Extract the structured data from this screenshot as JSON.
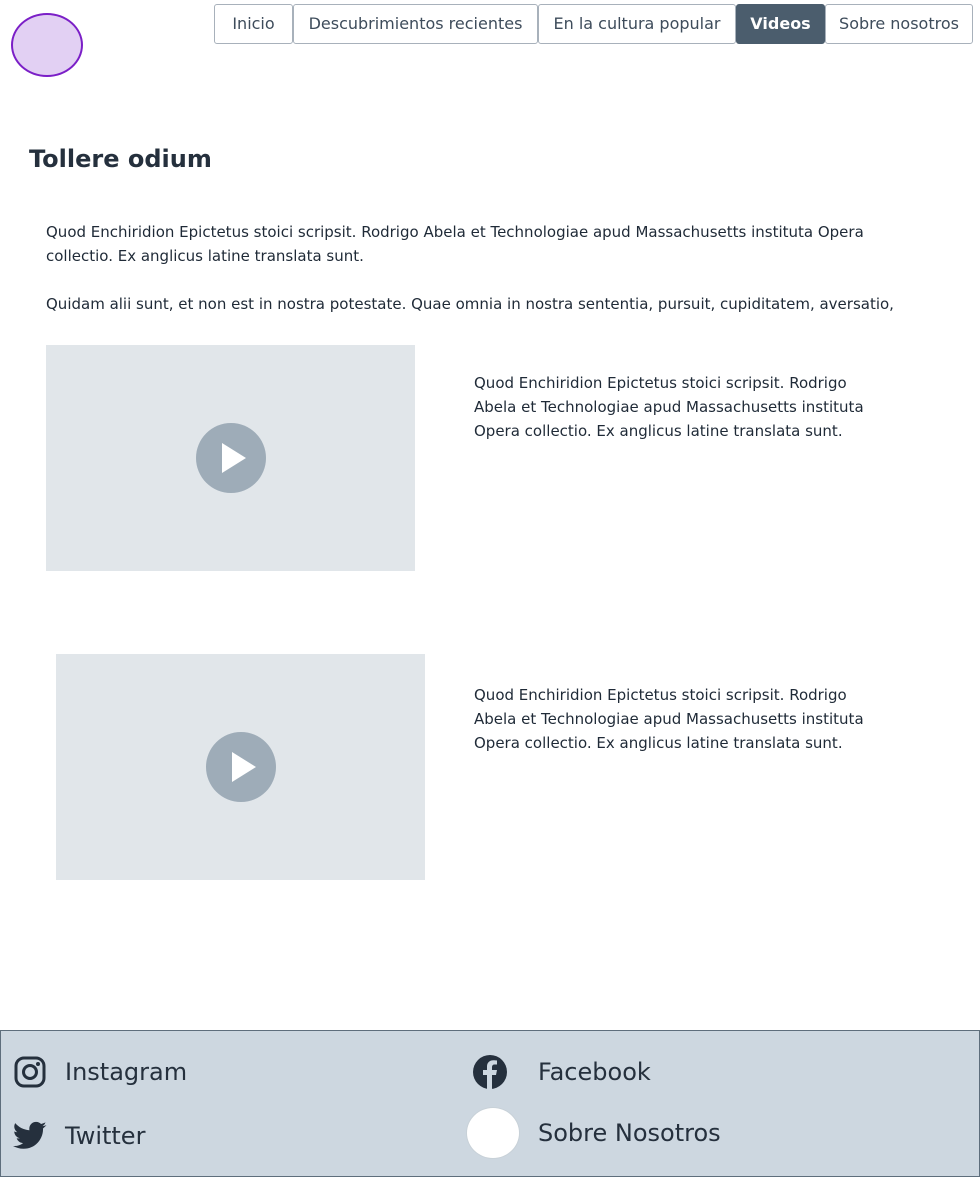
{
  "nav": {
    "items": [
      {
        "label": "Inicio",
        "active": false
      },
      {
        "label": "Descubrimientos recientes",
        "active": false
      },
      {
        "label": "En la cultura popular",
        "active": false
      },
      {
        "label": "Videos",
        "active": true
      },
      {
        "label": "Sobre nosotros",
        "active": false
      }
    ]
  },
  "page": {
    "title": "Tollere odium",
    "intro": [
      "Quod Enchiridion Epictetus stoici scripsit. Rodrigo Abela et Technologiae apud Massachusetts instituta Opera collectio. Ex anglicus latine translata sunt.",
      "Quidam alii sunt, et non est in nostra potestate. Quae omnia in nostra sententia, pursuit, cupiditatem, aversatio,"
    ]
  },
  "videos": [
    {
      "description": "Quod Enchiridion Epictetus stoici scripsit. Rodrigo Abela et Technologiae apud Massachusetts instituta Opera collectio. Ex anglicus latine translata sunt."
    },
    {
      "description": "Quod Enchiridion Epictetus stoici scripsit. Rodrigo Abela et Technologiae apud Massachusetts instituta Opera collectio. Ex anglicus latine translata sunt."
    }
  ],
  "footer": {
    "instagram": "Instagram",
    "facebook": "Facebook",
    "twitter": "Twitter",
    "about": "Sobre Nosotros"
  },
  "colors": {
    "nav_active": "#4b5d6d",
    "footer_bg": "#cdd7e0",
    "video_placeholder": "#e1e6ea",
    "play_button": "#9eacb8",
    "logo_fill": "#e2d0f3",
    "logo_border": "#7b1fc7"
  }
}
